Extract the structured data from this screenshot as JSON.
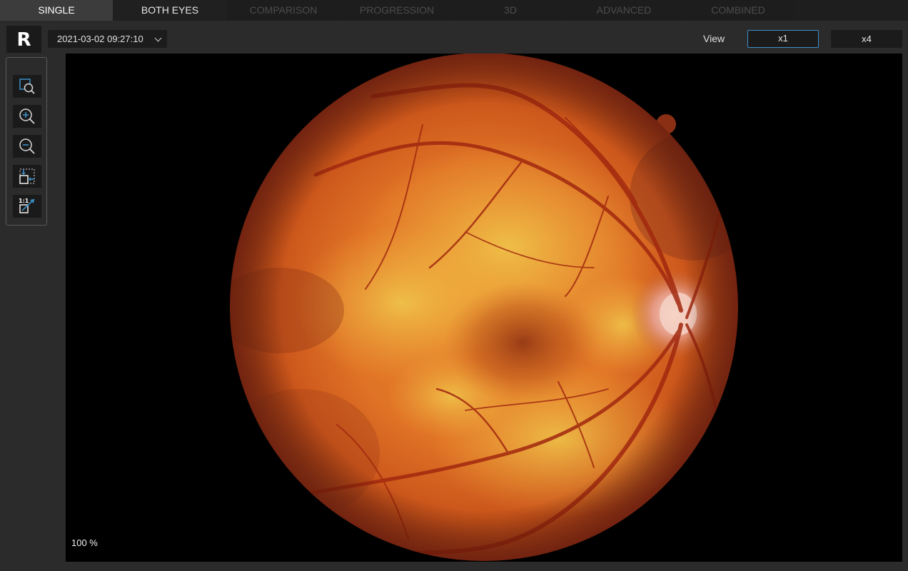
{
  "tabs": [
    {
      "label": "SINGLE",
      "state": "active"
    },
    {
      "label": "BOTH EYES",
      "state": "enabled"
    },
    {
      "label": "COMPARISON",
      "state": "disabled"
    },
    {
      "label": "PROGRESSION",
      "state": "disabled"
    },
    {
      "label": "3D",
      "state": "disabled"
    },
    {
      "label": "ADVANCED",
      "state": "disabled"
    },
    {
      "label": "COMBINED",
      "state": "disabled"
    }
  ],
  "header": {
    "eye": "R",
    "exam_date": "2021-03-02 09:27:10",
    "view_label": "View",
    "view_options": [
      "x1",
      "x4"
    ],
    "view_selected": "x1"
  },
  "toolbar": {
    "tools": [
      {
        "icon": "zoom-area-icon"
      },
      {
        "icon": "zoom-in-icon"
      },
      {
        "icon": "zoom-out-icon"
      },
      {
        "icon": "fit-to-window-icon"
      },
      {
        "icon": "actual-size-icon",
        "label": "1:1"
      }
    ]
  },
  "viewer": {
    "image": "retinal-fundus-photo",
    "zoom": "100 %"
  },
  "colors": {
    "accent": "#3d8fc7",
    "background": "#2b2b2b",
    "viewer_bg": "#000000"
  }
}
